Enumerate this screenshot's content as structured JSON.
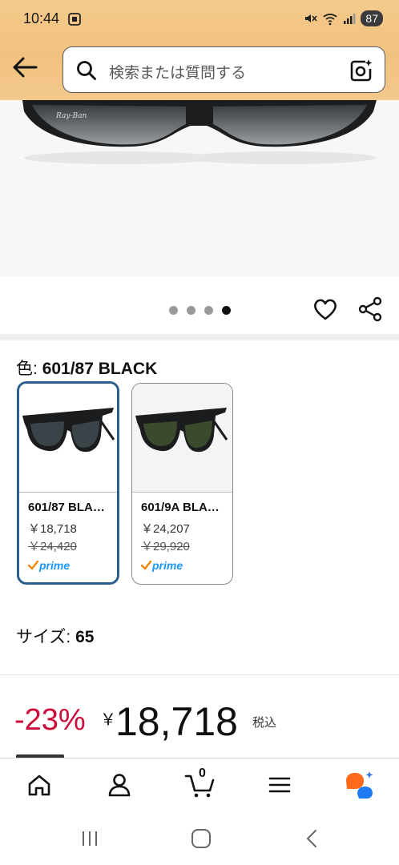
{
  "status_bar": {
    "time": "10:44",
    "battery": "87"
  },
  "search": {
    "placeholder": "検索または質問する"
  },
  "image_carousel": {
    "dot_count": 4,
    "active_index": 3
  },
  "color": {
    "label": "色:",
    "value": "601/87 BLACK"
  },
  "swatches": [
    {
      "name": "601/87 BLA…",
      "price": "￥18,718",
      "list_price": "￥24,420",
      "prime": "prime",
      "selected": true
    },
    {
      "name": "601/9A BLA…",
      "price": "￥24,207",
      "list_price": "￥29,920",
      "prime": "prime",
      "selected": false
    }
  ],
  "size": {
    "label": "サイズ:",
    "value": "65"
  },
  "price": {
    "discount": "-23%",
    "currency": "￥",
    "amount": "18,718",
    "tax_note": "税込"
  },
  "bottom_nav": {
    "cart_count": "0"
  },
  "colors": {
    "header": "#f1c27f",
    "discount": "#cc0c39",
    "selected_border": "#2a5f8f",
    "prime": "#1a98ff"
  }
}
